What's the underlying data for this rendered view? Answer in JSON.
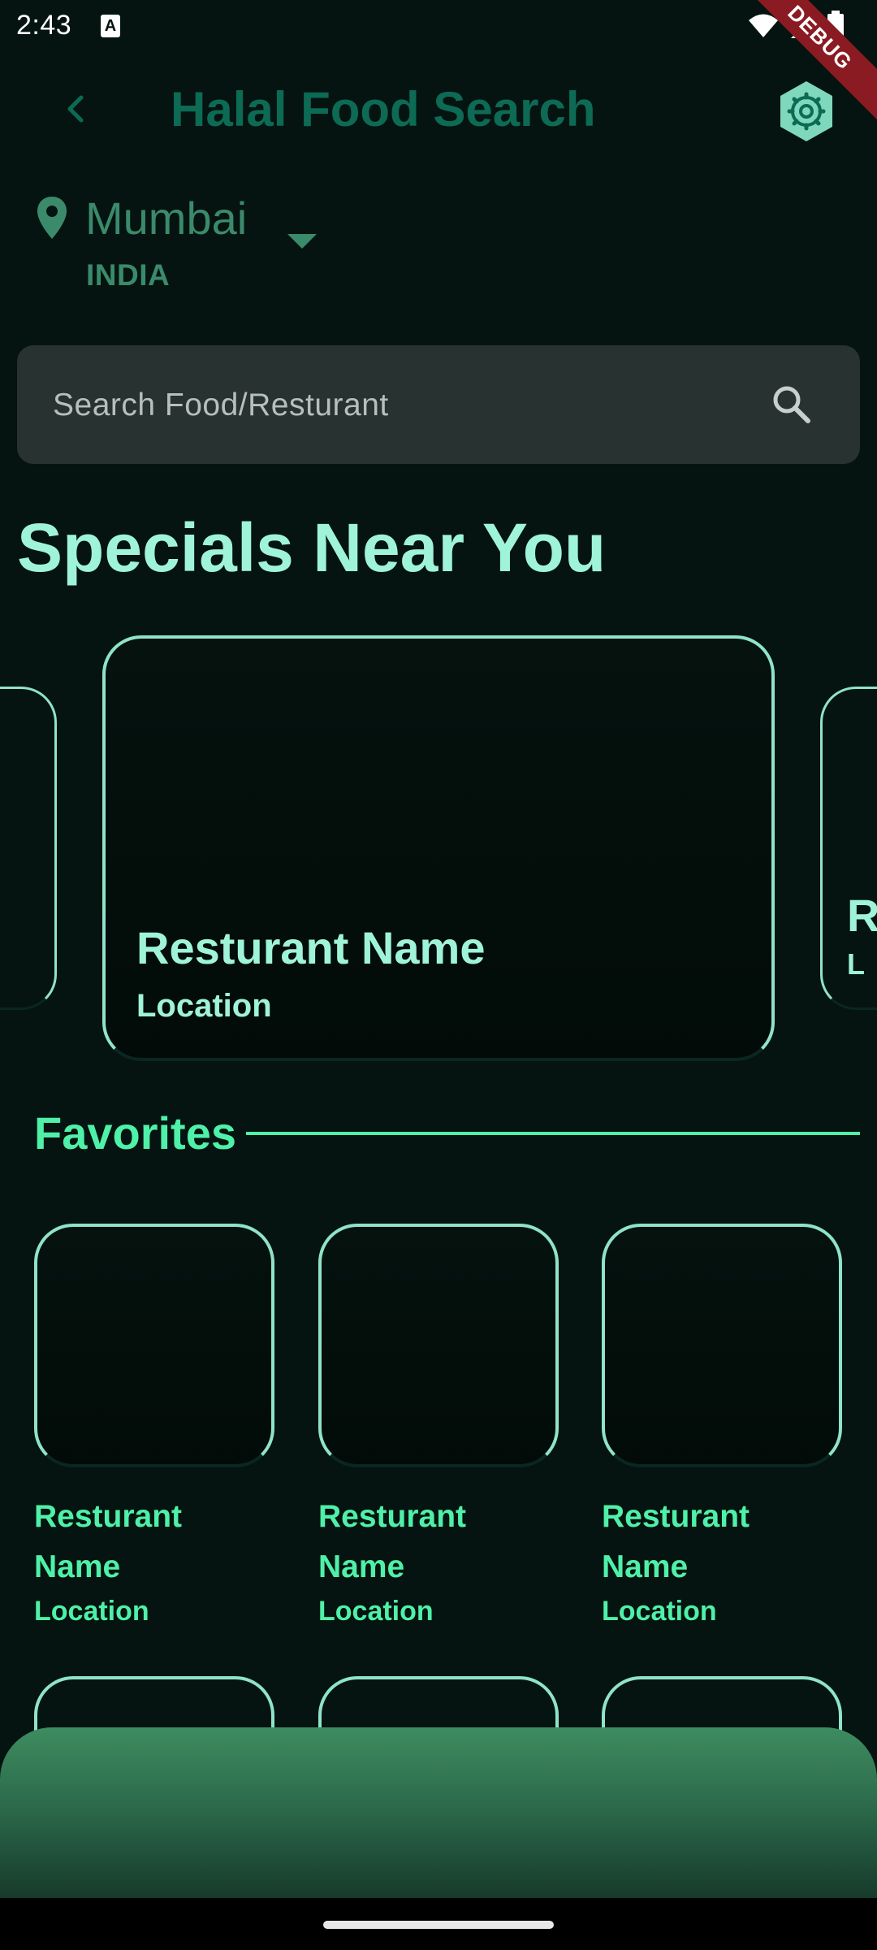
{
  "status_bar": {
    "time": "2:43",
    "notification_glyph": "A"
  },
  "debug_banner": "DEBUG",
  "app_bar": {
    "title": "Halal Food Search",
    "back_icon": "chevron-left-icon",
    "settings_icon": "gear-icon"
  },
  "location": {
    "city": "Mumbai",
    "country": "INDIA"
  },
  "search": {
    "placeholder": "Search Food/Resturant",
    "value": ""
  },
  "specials": {
    "title": "Specials Near You",
    "featured": {
      "name": "Resturant Name",
      "location": "Location"
    },
    "peek_right": {
      "name": "R",
      "location": "L"
    }
  },
  "favorites": {
    "title": "Favorites",
    "items": [
      {
        "name": "Resturant Name",
        "location": "Location"
      },
      {
        "name": "Resturant Name",
        "location": "Location"
      },
      {
        "name": "Resturant Name",
        "location": "Location"
      }
    ]
  },
  "colors": {
    "background": "#051410",
    "accent": "#9ff3d9",
    "favorites_accent": "#4ff0a8",
    "title_green": "#0d6a55",
    "location_green": "#3b8a6b"
  }
}
